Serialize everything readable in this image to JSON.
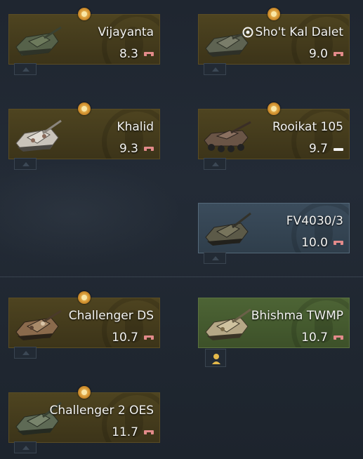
{
  "vehicles": [
    {
      "name": "Vijayanta",
      "br": "8.3",
      "style": "premium",
      "rank_icon": "ground-vehicle-icon",
      "premium_icon": true
    },
    {
      "name": "Sho't Kal Dalet",
      "br": "9.0",
      "style": "premium",
      "rank_icon": "ground-vehicle-icon",
      "premium_icon": true,
      "name_prefix_icon": "target-icon"
    },
    {
      "name": "Khalid",
      "br": "9.3",
      "style": "premium",
      "rank_icon": "ground-vehicle-icon",
      "premium_icon": true
    },
    {
      "name": "Rooikat 105",
      "br": "9.7",
      "style": "premium",
      "rank_icon": "light-vehicle-icon",
      "premium_icon": true
    },
    {
      "name": "FV4030/3",
      "br": "10.0",
      "style": "researched",
      "rank_icon": "ground-vehicle-icon",
      "premium_icon": false
    },
    {
      "name": "Challenger DS",
      "br": "10.7",
      "style": "premium",
      "rank_icon": "ground-vehicle-icon",
      "premium_icon": true
    },
    {
      "name": "Bhishma TWMP",
      "br": "10.7",
      "style": "owned",
      "rank_icon": "ground-vehicle-icon",
      "premium_icon": false
    },
    {
      "name": "Challenger 2 OES",
      "br": "11.7",
      "style": "premium",
      "rank_icon": "ground-vehicle-icon",
      "premium_icon": true
    }
  ],
  "colors": {
    "premium_card": "#4e4420",
    "researched_card": "#3b4c5c",
    "owned_card": "#4d6435",
    "background": "#1f2630",
    "rank_icon_red": "#e28a8a"
  }
}
